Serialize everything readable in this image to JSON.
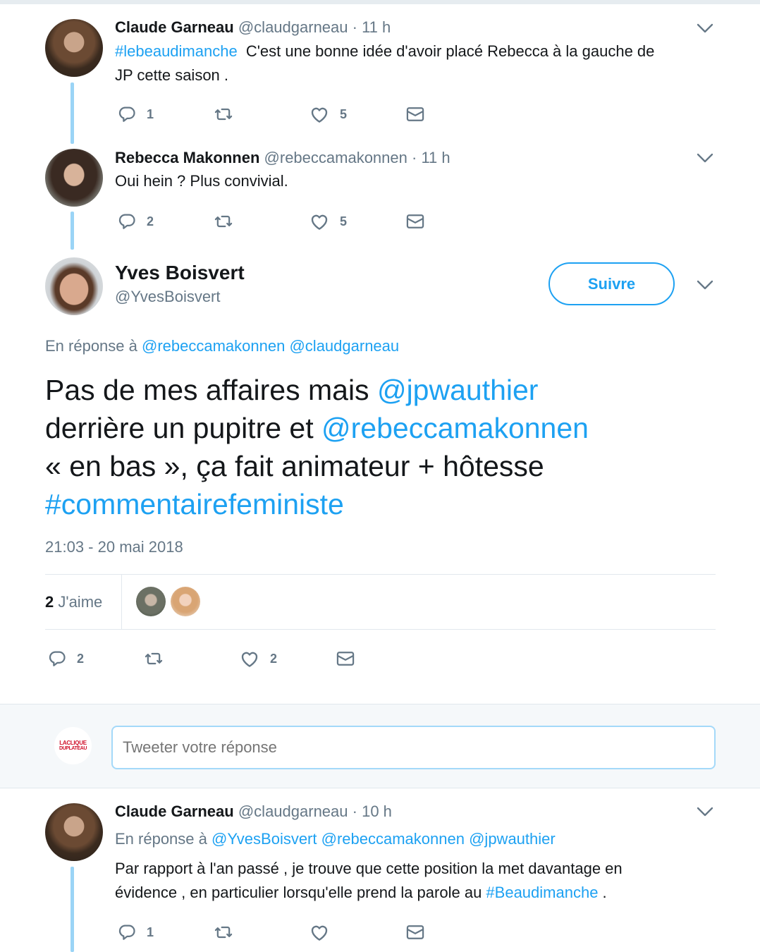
{
  "tweet1": {
    "name": "Claude Garneau",
    "handle": "@claudgarneau",
    "time": "· 11 h",
    "hashtag": "#lebeaudimanche",
    "text_a": " C'est une bonne idée d'avoir placé Rebecca à la gauche de",
    "text_b": "JP cette saison .",
    "replies": "1",
    "likes": "5"
  },
  "tweet2": {
    "name": "Rebecca Makonnen",
    "handle": "@rebeccamakonnen",
    "time": "· 11 h",
    "text": "Oui hein ? Plus convivial.",
    "replies": "2",
    "likes": "5"
  },
  "main_tweet": {
    "name": "Yves Boisvert",
    "handle": "@YvesBoisvert",
    "follow_label": "Suivre",
    "reply_prefix": "En réponse à",
    "reply_to_1": "@rebeccamakonnen",
    "reply_to_2": "@claudgarneau",
    "l1_a": "Pas de mes affaires mais ",
    "l1_mention": "@jpwauthier",
    "l2_a": "derrière un pupitre et ",
    "l2_mention": "@rebeccamakonnen",
    "l3": "« en bas », ça fait animateur + hôtesse",
    "l4_hashtag": "#commentairefeministe",
    "timestamp": "21:03 - 20 mai 2018",
    "likes_count": "2",
    "likes_label": "J'aime",
    "replies": "2",
    "likes": "2"
  },
  "compose": {
    "placeholder": "Tweeter votre réponse",
    "logo_line1": "LACLIQUE",
    "logo_line2": "DUPLATEAU"
  },
  "tweet4": {
    "name": "Claude Garneau",
    "handle": "@claudgarneau",
    "time": "· 10 h",
    "reply_prefix": "En réponse à",
    "reply_to_1": "@YvesBoisvert",
    "reply_to_2": "@rebeccamakonnen",
    "reply_to_3": "@jpwauthier",
    "text_a": "Par rapport à l'an passé , je trouve que cette position la met davantage en",
    "text_b": "évidence , en particulier lorsqu'elle prend la parole au ",
    "hashtag": "#Beaudimanche",
    "text_c": " .",
    "replies": "1"
  },
  "colors": {
    "link": "#1da1f2",
    "muted": "#657786",
    "thread_line": "#9ad4f6",
    "compose_bg": "#f5f8fa"
  },
  "icons": [
    "reply-icon",
    "retweet-icon",
    "like-icon",
    "message-icon",
    "chevron-down-icon"
  ]
}
